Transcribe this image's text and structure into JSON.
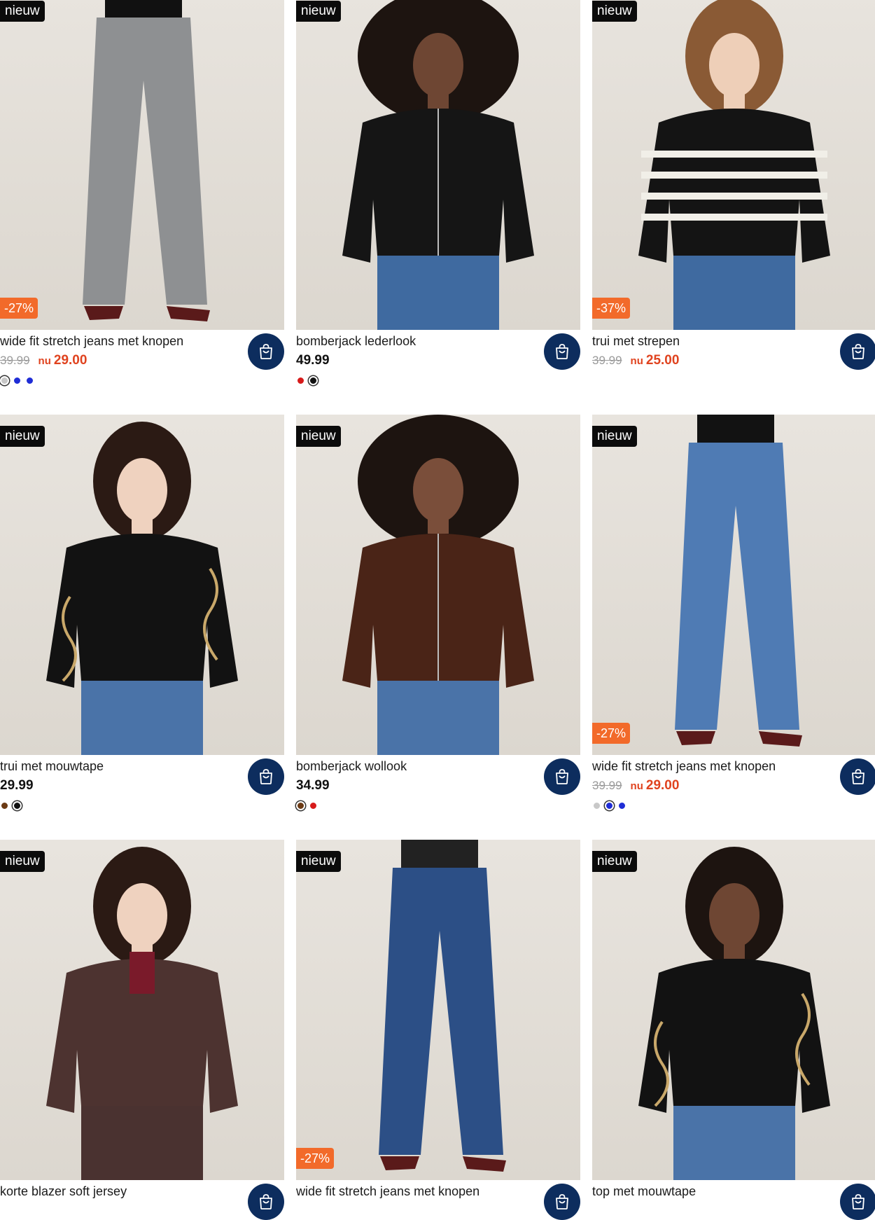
{
  "products": [
    {
      "name": "wide fit stretch jeans met knopen",
      "badge": "nieuw",
      "discount": "-27%",
      "price_old": "39.99",
      "price_prefix": "nu",
      "price": "29.00",
      "swatches": [
        {
          "color": "#c8c8c8",
          "selected": true
        },
        {
          "color": "#1f2dd6",
          "selected": false
        },
        {
          "color": "#1f2dd6",
          "selected": false
        }
      ]
    },
    {
      "name": "bomberjack lederlook",
      "badge": "nieuw",
      "discount": "",
      "price_old": "",
      "price_prefix": "",
      "price": "49.99",
      "swatches": [
        {
          "color": "#d71a1a",
          "selected": false
        },
        {
          "color": "#111111",
          "selected": true
        }
      ]
    },
    {
      "name": "trui met strepen",
      "badge": "nieuw",
      "discount": "-37%",
      "price_old": "39.99",
      "price_prefix": "nu",
      "price": "25.00",
      "swatches": []
    },
    {
      "name": "trui met mouwtape",
      "badge": "nieuw",
      "discount": "",
      "price_old": "",
      "price_prefix": "",
      "price": "29.99",
      "swatches": [
        {
          "color": "#6b3a14",
          "selected": false
        },
        {
          "color": "#111111",
          "selected": true
        }
      ]
    },
    {
      "name": "bomberjack wollook",
      "badge": "nieuw",
      "discount": "",
      "price_old": "",
      "price_prefix": "",
      "price": "34.99",
      "swatches": [
        {
          "color": "#6b3a14",
          "selected": true
        },
        {
          "color": "#d71a1a",
          "selected": false
        }
      ]
    },
    {
      "name": "wide fit stretch jeans met knopen",
      "badge": "nieuw",
      "discount": "-27%",
      "price_old": "39.99",
      "price_prefix": "nu",
      "price": "29.00",
      "swatches": [
        {
          "color": "#c8c8c8",
          "selected": false
        },
        {
          "color": "#1f2dd6",
          "selected": true
        },
        {
          "color": "#1f2dd6",
          "selected": false
        }
      ]
    },
    {
      "name": "korte blazer soft jersey",
      "badge": "nieuw",
      "discount": "",
      "price_old": "",
      "price_prefix": "",
      "price": "",
      "swatches": []
    },
    {
      "name": "wide fit stretch jeans met knopen",
      "badge": "nieuw",
      "discount": "-27%",
      "price_old": "",
      "price_prefix": "",
      "price": "",
      "swatches": []
    },
    {
      "name": "top met mouwtape",
      "badge": "nieuw",
      "discount": "",
      "price_old": "",
      "price_prefix": "",
      "price": "",
      "swatches": []
    }
  ],
  "theme": {
    "cart_button": "#0d2d5e",
    "discount_badge": "#f26a2a",
    "sale_price": "#e0431f",
    "new_badge": "#0b0b0b"
  },
  "icons": {
    "cart": "shopping-bag-icon"
  }
}
